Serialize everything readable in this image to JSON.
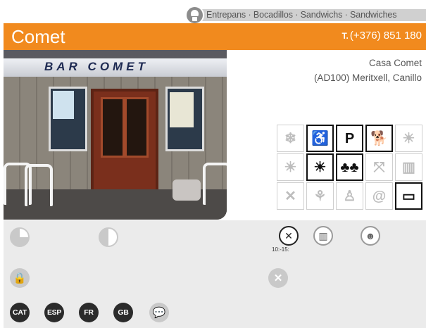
{
  "top_strip": {
    "categories": "Entrepans · Bocadillos · Sandwichs · Sandwiches",
    "icon": "chef-hat-icon"
  },
  "header": {
    "title": "Comet",
    "phone_prefix": "T.",
    "phone": "(+376) 851 180",
    "background": "#f18a1e"
  },
  "photo": {
    "sign_text": "BAR COMET"
  },
  "address": {
    "line1": "Casa Comet",
    "line2": "(AD100) Meritxell, Canillo"
  },
  "services": [
    {
      "icon": "snowflake-icon",
      "glyph": "❄",
      "active": false
    },
    {
      "icon": "wheelchair-icon",
      "glyph": "♿",
      "active": true
    },
    {
      "icon": "parking-icon",
      "glyph": "P",
      "active": true
    },
    {
      "icon": "pets-icon",
      "glyph": "🐕",
      "active": true
    },
    {
      "icon": "sun-terrace-icon",
      "glyph": "☀",
      "active": false
    },
    {
      "icon": "sun-icon",
      "glyph": "☀",
      "active": false
    },
    {
      "icon": "sunny-terrace-icon",
      "glyph": "☀",
      "active": true
    },
    {
      "icon": "forest-icon",
      "glyph": "♣♣",
      "active": true
    },
    {
      "icon": "expand-icon",
      "glyph": "⤧",
      "active": false
    },
    {
      "icon": "menu-icon",
      "glyph": "▥",
      "active": false
    },
    {
      "icon": "cutlery-icon",
      "glyph": "✕",
      "active": false
    },
    {
      "icon": "no-gluten-icon",
      "glyph": "⚘",
      "active": false
    },
    {
      "icon": "chef-icon",
      "glyph": "♙",
      "active": false
    },
    {
      "icon": "email-icon",
      "glyph": "@",
      "active": false
    },
    {
      "icon": "credit-card-icon",
      "glyph": "▭",
      "active": true
    }
  ],
  "panel": {
    "hours_label": "10:-15:",
    "languages": [
      "CAT",
      "ESP",
      "FR",
      "GB"
    ]
  }
}
